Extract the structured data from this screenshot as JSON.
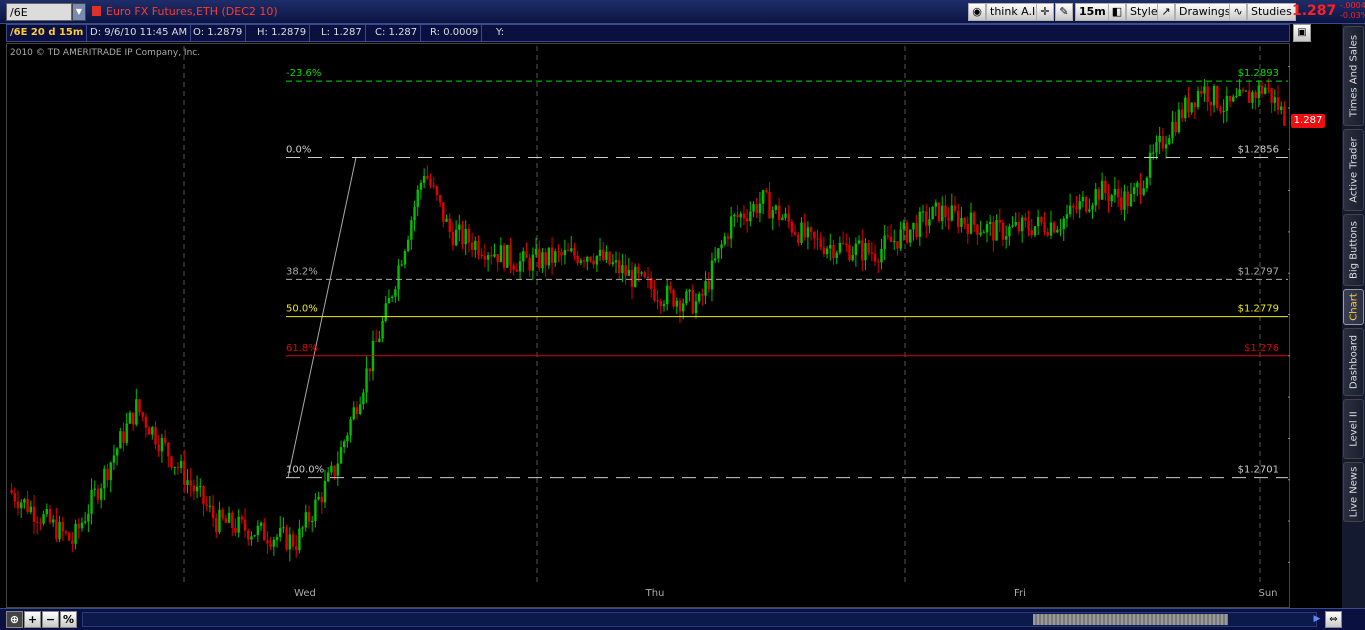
{
  "titlebar": {
    "symbol": "/6E",
    "dropdown_glyph": "▼",
    "title": "Euro FX Futures,ETH (DEC2 10)",
    "think_ai_label": "think A.I.",
    "timeframe": "15m",
    "style_label": "Style",
    "drawings_label": "Drawings",
    "studies_label": "Studies",
    "last_price": "1.287",
    "change_abs": "-.0004",
    "change_pct": "-0.03%"
  },
  "infobar": {
    "symbol": "/6E 20 d 15m",
    "date": "D: 9/6/10 11:45 AM",
    "open": "O: 1.2879",
    "high": "H: 1.2879",
    "low": "L: 1.287",
    "close": "C: 1.287",
    "range": "R: 0.0009",
    "y": "Y:"
  },
  "copyright": "2010 © TD AMERITRADE IP Company, Inc.",
  "price_tag": "1.287",
  "side_tabs": [
    "Times And Sales",
    "Active Trader",
    "Big Buttons",
    "Chart",
    "Dashboard",
    "Level II",
    "Live News"
  ],
  "active_tab": "Chart",
  "bottombar": {
    "zoom_in": "+",
    "zoom_out": "−",
    "percent": "%",
    "corner": "⇔"
  },
  "colors": {
    "up": "#00c000",
    "down": "#e00000",
    "fib_minus": "#00dd00",
    "fib_50": "#eeee00",
    "fib_618": "#e00000",
    "fib_default": "#cccccc"
  },
  "chart_data": {
    "type": "candlestick",
    "title": "Euro FX Futures,ETH (DEC2 10)",
    "ylim": [
      1.265,
      1.291
    ],
    "y_ticks": [
      1.266,
      1.268,
      1.27,
      1.272,
      1.274,
      1.276,
      1.278,
      1.28,
      1.282,
      1.284,
      1.286,
      1.288,
      1.29
    ],
    "x_labels": [
      {
        "label": "Wed",
        "at": 0.24
      },
      {
        "label": "Thu",
        "at": 0.52
      },
      {
        "label": "Fri",
        "at": 0.8
      },
      {
        "label": "Sun",
        "at": 0.983
      }
    ],
    "fib_levels": [
      {
        "pct": "-23.6%",
        "price": "$1.2893",
        "value": 1.2893,
        "color": "#00dd00",
        "dash": "6,4"
      },
      {
        "pct": "0.0%",
        "price": "$1.2856",
        "value": 1.2856,
        "color": "#cccccc",
        "dash": "14,8"
      },
      {
        "pct": "38.2%",
        "price": "$1.2797",
        "value": 1.2797,
        "color": "#aaaaaa",
        "dash": "6,4"
      },
      {
        "pct": "50.0%",
        "price": "$1.2779",
        "value": 1.2779,
        "color": "#eeee00",
        "dash": ""
      },
      {
        "pct": "61.8%",
        "price": "$1.276",
        "value": 1.276,
        "color": "#e00000",
        "dash": ""
      },
      {
        "pct": "100.0%",
        "price": "$1.2701",
        "value": 1.2701,
        "color": "#cccccc",
        "dash": "14,8"
      }
    ],
    "segments": [
      {
        "n": 20,
        "from": 1.2695,
        "to": 1.267
      },
      {
        "n": 20,
        "from": 1.267,
        "to": 1.2735
      },
      {
        "n": 25,
        "from": 1.2735,
        "to": 1.268
      },
      {
        "n": 25,
        "from": 1.268,
        "to": 1.267
      },
      {
        "n": 12,
        "from": 1.267,
        "to": 1.2705
      },
      {
        "n": 16,
        "from": 1.2705,
        "to": 1.278
      },
      {
        "n": 12,
        "from": 1.278,
        "to": 1.285
      },
      {
        "n": 8,
        "from": 1.285,
        "to": 1.282
      },
      {
        "n": 22,
        "from": 1.282,
        "to": 1.2805
      },
      {
        "n": 22,
        "from": 1.2805,
        "to": 1.281
      },
      {
        "n": 22,
        "from": 1.281,
        "to": 1.279
      },
      {
        "n": 12,
        "from": 1.279,
        "to": 1.2785
      },
      {
        "n": 10,
        "from": 1.2785,
        "to": 1.2825
      },
      {
        "n": 10,
        "from": 1.2825,
        "to": 1.2835
      },
      {
        "n": 15,
        "from": 1.2835,
        "to": 1.2815
      },
      {
        "n": 20,
        "from": 1.2815,
        "to": 1.281
      },
      {
        "n": 20,
        "from": 1.281,
        "to": 1.283
      },
      {
        "n": 18,
        "from": 1.283,
        "to": 1.282
      },
      {
        "n": 20,
        "from": 1.282,
        "to": 1.2825
      },
      {
        "n": 12,
        "from": 1.2825,
        "to": 1.284
      },
      {
        "n": 10,
        "from": 1.284,
        "to": 1.2835
      },
      {
        "n": 12,
        "from": 1.2835,
        "to": 1.287
      },
      {
        "n": 10,
        "from": 1.287,
        "to": 1.289
      },
      {
        "n": 8,
        "from": 1.289,
        "to": 1.288
      },
      {
        "n": 12,
        "from": 1.288,
        "to": 1.289
      },
      {
        "n": 6,
        "from": 1.289,
        "to": 1.2876
      }
    ]
  }
}
